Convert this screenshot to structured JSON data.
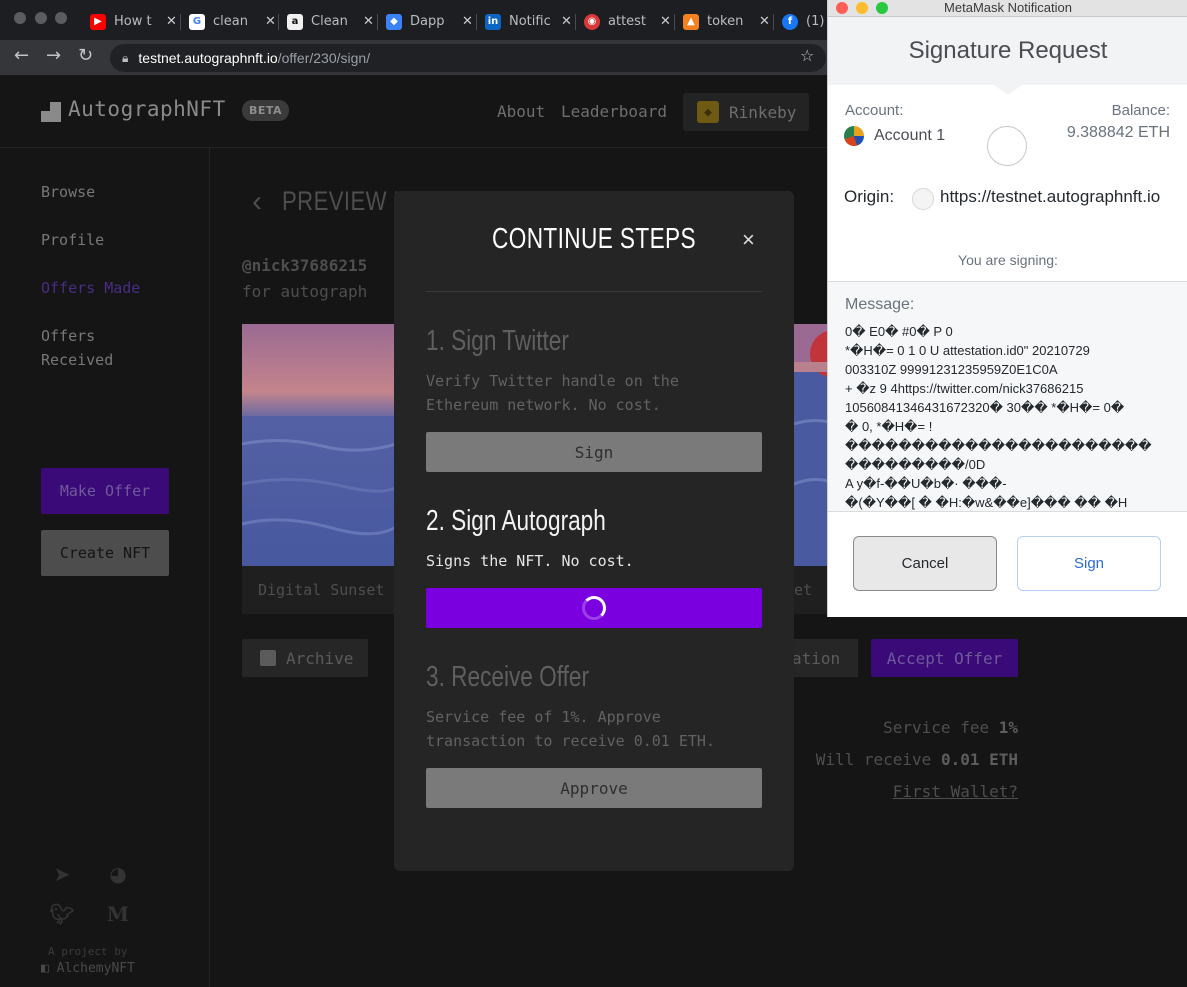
{
  "browser": {
    "tabs": [
      {
        "label": "How t",
        "icon": "youtube-icon",
        "color": "#ff0000"
      },
      {
        "label": "clean",
        "icon": "google-icon",
        "color": "#ffffff"
      },
      {
        "label": "Clean",
        "icon": "amazon-icon",
        "color": "#f0f0f0"
      },
      {
        "label": "Dapp",
        "icon": "dapp-icon",
        "color": "#3b82f6"
      },
      {
        "label": "Notific",
        "icon": "linkedin-icon",
        "color": "#0a66c2"
      },
      {
        "label": "attest",
        "icon": "attest-icon",
        "color": "#d93838"
      },
      {
        "label": "token",
        "icon": "token-icon",
        "color": "#f4811f"
      },
      {
        "label": "(1)",
        "icon": "facebook-icon",
        "color": "#1877f2"
      }
    ],
    "url_host": "testnet.autographnft.io",
    "url_path": "/offer/230/sign/"
  },
  "site": {
    "logo": "AutographNFT",
    "beta": "BETA",
    "nav": {
      "about": "About",
      "leaderboard": "Leaderboard",
      "network": "Rinkeby"
    },
    "sidebar": {
      "browse": "Browse",
      "profile": "Profile",
      "offers_made": "Offers Made",
      "offers_received_1": "Offers",
      "offers_received_2": "Received",
      "make_offer": "Make Offer",
      "create_nft": "Create NFT",
      "project_by": "A project by",
      "alchemy": "AlchemyNFT"
    },
    "preview_title": "PREVIEW REQUEST",
    "handle": "@nick37686215",
    "for_autograph": "for autograph",
    "nft_caption_left": "Digital Sunset",
    "nft_caption_right": "et",
    "archive": "Archive",
    "ation": "ation",
    "accept_offer": "Accept Offer",
    "service_fee_label": "Service fee",
    "service_fee_value": "1%",
    "will_receive_label": "Will receive",
    "will_receive_value": "0.01 ETH",
    "first_wallet": "First Wallet?"
  },
  "modal": {
    "title": "CONTINUE STEPS",
    "close": "×",
    "steps": [
      {
        "title": "1. Sign Twitter",
        "desc_1": "Verify Twitter handle on the",
        "desc_2": "Ethereum network. No cost.",
        "button": "Sign",
        "state": "done"
      },
      {
        "title": "2. Sign Autograph",
        "desc_1": "Signs the NFT. No cost.",
        "desc_2": "",
        "button": "",
        "state": "loading"
      },
      {
        "title": "3. Receive Offer",
        "desc_1": "Service fee of 1%. Approve",
        "desc_2": "transaction to receive 0.01 ETH.",
        "button": "Approve",
        "state": "pending"
      }
    ],
    "accent": "#7a00e0"
  },
  "metamask": {
    "window_title": "MetaMask Notification",
    "title": "Signature Request",
    "account_label": "Account:",
    "account_name": "Account 1",
    "balance_label": "Balance:",
    "balance": "9.388842 ETH",
    "origin_label": "Origin:",
    "origin": "https://testnet.autographnft.io",
    "signing": "You are signing:",
    "message_label": "Message:",
    "message_lines": [
      "0� E0� #0� P       0",
      "  *�H�=  0 1 0   U    attestation.id0\"  20210729",
      "003310Z  99991231235959Z0E1C0A",
      "+     �z 9 4https://twitter.com/nick37686215",
      "10560841346431672320� 30��   *�H�=  0�",
      "�   0,  *�H�=  !",
      "�����������������������",
      "���������/0D",
      "  A y�f-��U�b�·   ���-",
      "�(�Y��[ �  �H:�w&��e]���   �� �H"
    ],
    "cancel": "Cancel",
    "sign": "Sign"
  }
}
